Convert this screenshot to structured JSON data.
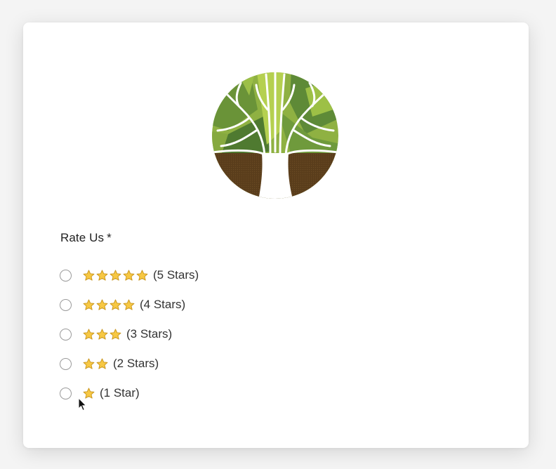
{
  "form": {
    "question_label": "Rate Us",
    "required_marker": "*",
    "options": [
      {
        "stars": 5,
        "label": "(5 Stars)"
      },
      {
        "stars": 4,
        "label": "(4 Stars)"
      },
      {
        "stars": 3,
        "label": "(3 Stars)"
      },
      {
        "stars": 2,
        "label": "(2 Stars)"
      },
      {
        "stars": 1,
        "label": "(1 Star)"
      }
    ]
  },
  "logo": {
    "icon": "tree-logo-icon"
  },
  "colors": {
    "star_fill": "#f7c843",
    "star_stroke": "#c9961e",
    "leaf_dark": "#5e8a37",
    "leaf_light": "#a7c84a",
    "trunk_brown": "#5a3d1b"
  }
}
